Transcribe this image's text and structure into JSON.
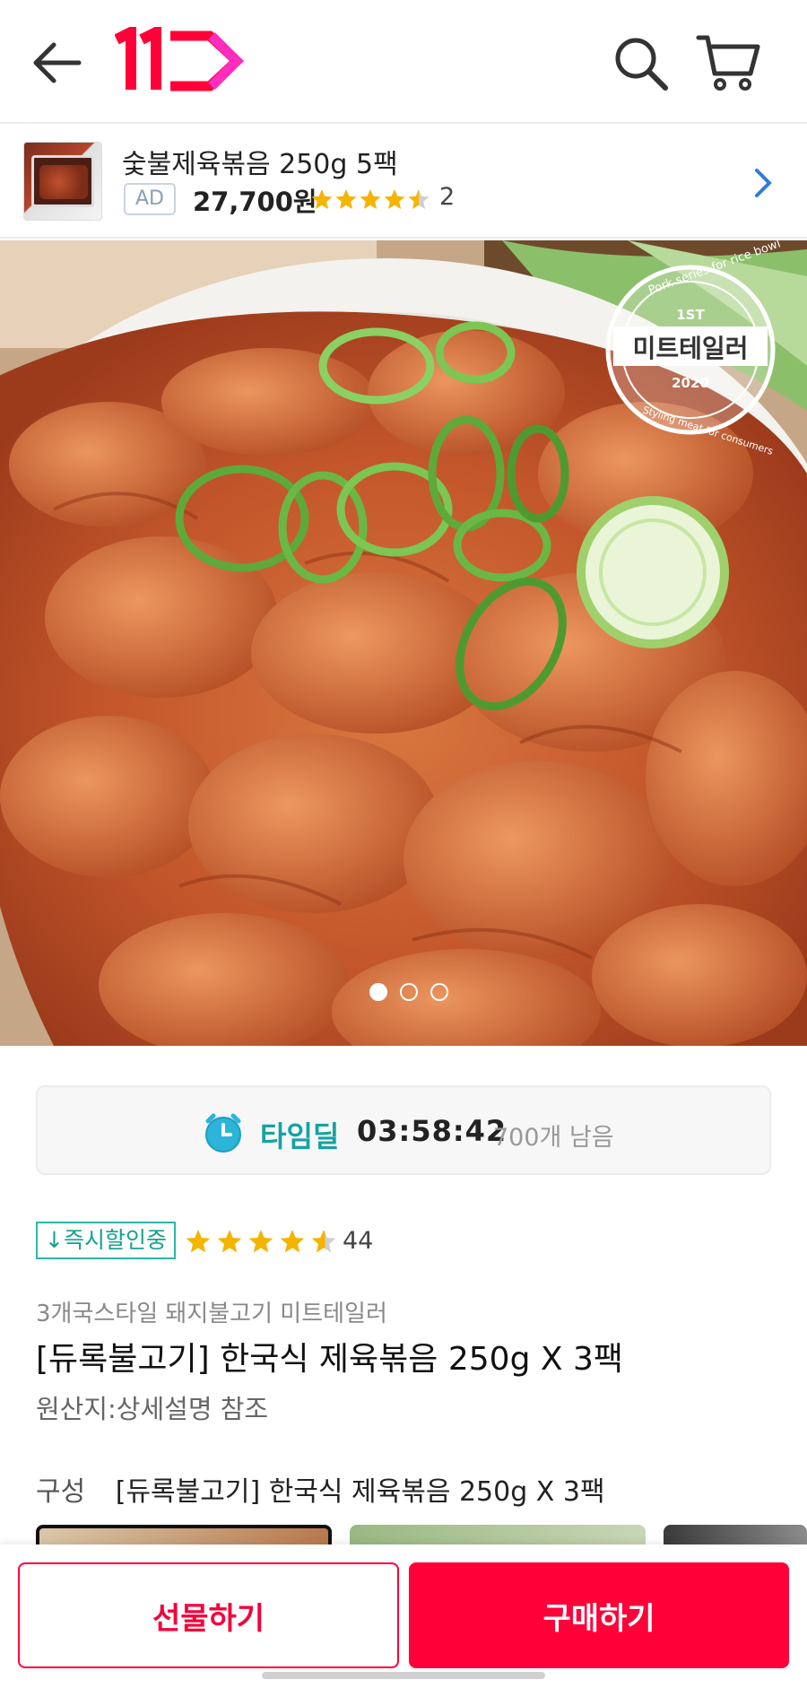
{
  "header": {
    "back_icon": "arrow-left-icon",
    "logo_text": "11",
    "search_icon": "search-icon",
    "cart_icon": "cart-icon",
    "brand_color": "#ff0038"
  },
  "ad": {
    "title": "숯불제육볶음 250g 5팩",
    "badge": "AD",
    "price": "27,700원",
    "rating": 4.5,
    "rating_count": "2",
    "chevron_icon": "chevron-right-icon"
  },
  "hero": {
    "stamp_top": "Pork series for rice bowl",
    "stamp_rank": "1ST",
    "stamp_brand": "미트테일러",
    "stamp_year": "2020",
    "stamp_bottom": "Styling meat for consumers",
    "carousel_total": 3,
    "carousel_active": 1
  },
  "timedeal": {
    "icon": "alarm-clock-icon",
    "label": "타임딜",
    "time": "03:58:42",
    "remaining": "700개 남음",
    "accent": "#15a3a1"
  },
  "product": {
    "instant_badge": "↓즉시할인중",
    "rating": 4.5,
    "review_count": "44",
    "subtitle": "3개국스타일 돼지불고기 미트테일러",
    "title": "[듀록불고기] 한국식 제육볶음 250g X 3팩",
    "origin": "원산지:상세설명 참조",
    "option_label": "구성",
    "option_value": "[듀록불고기] 한국식 제육볶음 250g X 3팩"
  },
  "bottom": {
    "gift_label": "선물하기",
    "buy_label": "구매하기"
  }
}
